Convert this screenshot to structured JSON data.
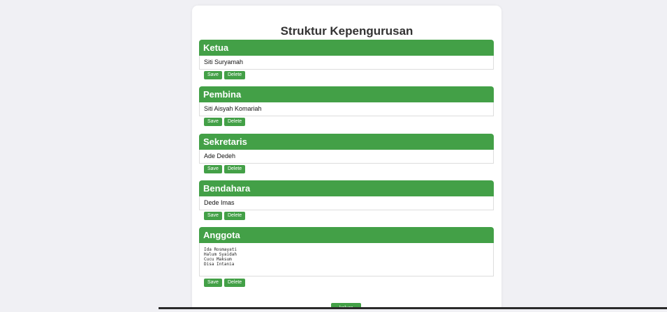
{
  "page": {
    "title": "Struktur Kepengurusan"
  },
  "sections": [
    {
      "heading": "Ketua",
      "value": "Siti Suryamah",
      "save_label": "Save",
      "delete_label": "Delete"
    },
    {
      "heading": "Pembina",
      "value": "Siti Aisyah Komariah",
      "save_label": "Save",
      "delete_label": "Delete"
    },
    {
      "heading": "Sekretaris",
      "value": "Ade Dedeh",
      "save_label": "Save",
      "delete_label": "Delete"
    },
    {
      "heading": "Bendahara",
      "value": "Dede Imas",
      "save_label": "Save",
      "delete_label": "Delete"
    },
    {
      "heading": "Anggota",
      "value": "Ida Rosmayati\nHalum Syaidah\nCucu Maksum\nDisa Intania",
      "save_label": "Save",
      "delete_label": "Delete"
    }
  ],
  "logout_label": "keluar",
  "colors": {
    "accent": "#43a047",
    "background": "#f0f0f4",
    "card": "#ffffff"
  }
}
